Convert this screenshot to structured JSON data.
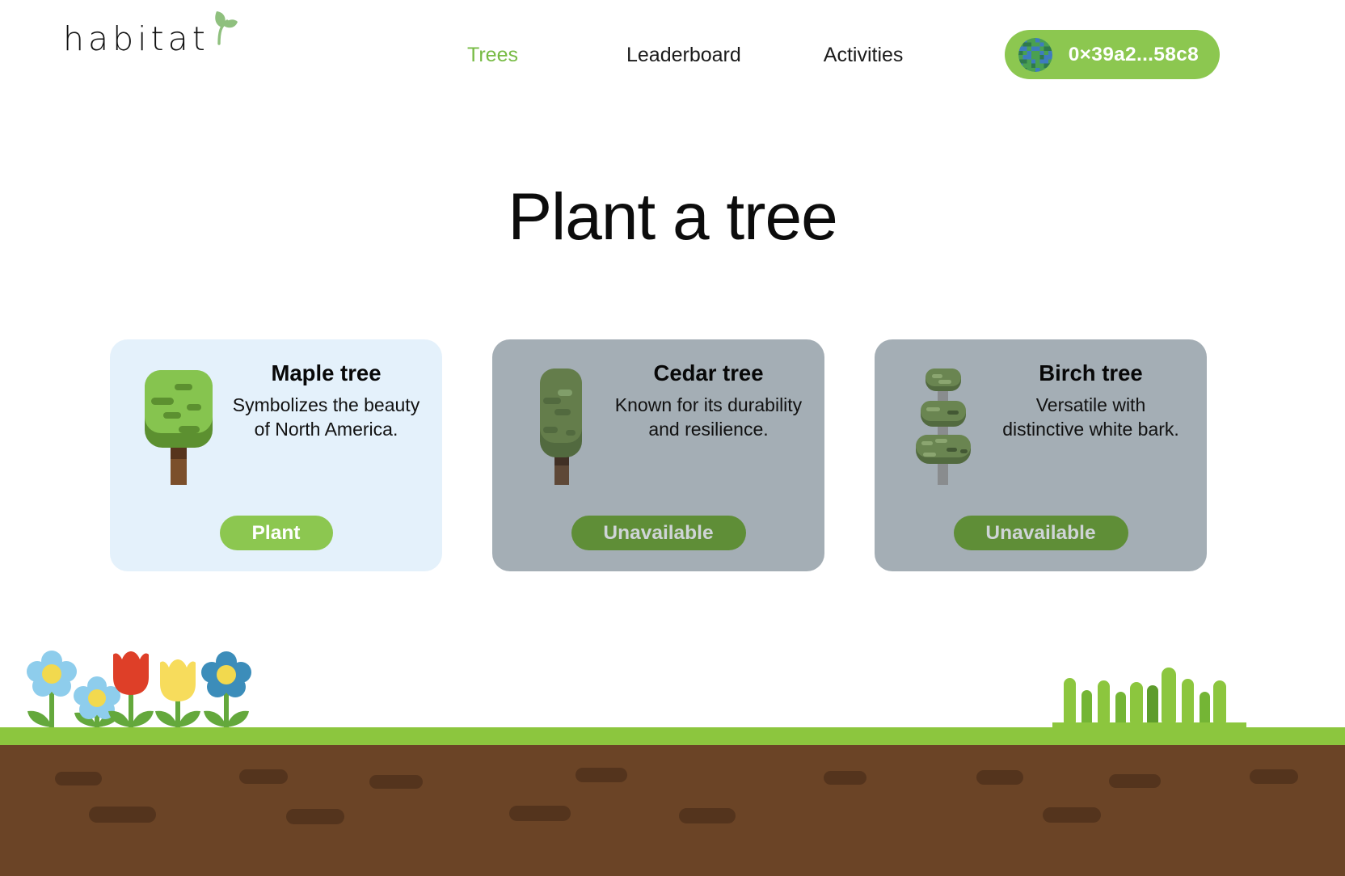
{
  "brand": {
    "word": "habitat",
    "icon": "sprout-icon"
  },
  "nav": {
    "items": [
      {
        "label": "Trees",
        "active": true
      },
      {
        "label": "Leaderboard",
        "active": false
      },
      {
        "label": "Activities",
        "active": false
      }
    ]
  },
  "wallet": {
    "address": "0×39a2...58c8",
    "avatar_icon": "blockie-avatar-icon",
    "background_color": "#8cc750"
  },
  "page": {
    "title": "Plant a tree",
    "background_color": "#ffffff"
  },
  "cards": [
    {
      "name": "Maple tree",
      "description": "Symbolizes the beauty of North America.",
      "button_label": "Plant",
      "available": true,
      "card_color": "#e4f1fb",
      "button_color": "#8cc750",
      "art": "maple-tree-icon"
    },
    {
      "name": "Cedar tree",
      "description": "Known for its durability and resilience.",
      "button_label": "Unavailable",
      "available": false,
      "card_color": "#a4aeb5",
      "button_color": "#5f8e37",
      "art": "cedar-tree-icon"
    },
    {
      "name": "Birch tree",
      "description": "Versatile with distinctive white bark.",
      "button_label": "Unavailable",
      "available": false,
      "card_color": "#a4aeb5",
      "button_color": "#5f8e37",
      "art": "birch-tree-icon"
    }
  ],
  "scene": {
    "grass_color": "#8cc63e",
    "soil_color": "#6b4426",
    "pebble_color": "#54341d",
    "flowers": [
      {
        "type": "daisy",
        "petal_color": "#8ecdec",
        "center_color": "#f2d94e"
      },
      {
        "type": "daisy",
        "petal_color": "#8ecdec",
        "center_color": "#f2d94e"
      },
      {
        "type": "tulip",
        "petal_color": "#de3f28"
      },
      {
        "type": "tulip",
        "petal_color": "#f7dc5c"
      },
      {
        "type": "daisy",
        "petal_color": "#3c8dba",
        "center_color": "#f2d94e"
      }
    ],
    "bush_color": "#8cc63e"
  }
}
